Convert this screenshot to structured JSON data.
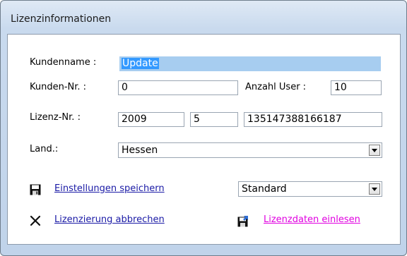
{
  "window": {
    "title": "Lizenzinformationen"
  },
  "form": {
    "kundenname_label": "Kundenname :",
    "kundenname_value": "Update",
    "kundennr_label": "Kunden-Nr. :",
    "kundennr_value": "0",
    "anzahl_user_label": "Anzahl User :",
    "anzahl_user_value": "10",
    "lizenznr_label": "Lizenz-Nr. :",
    "lizenznr_part1": "2009",
    "lizenznr_part2": "5",
    "lizenznr_part3": "135147388166187",
    "land_label": "Land.:",
    "land_value": "Hessen"
  },
  "actions": {
    "save_settings": "Einstellungen speichern",
    "profile_value": "Standard",
    "cancel_licensing": "Lizenzierung abbrechen",
    "read_license_data": "Lizenzdaten einlesen"
  },
  "colors": {
    "link": "#1a1aa6",
    "link_magenta": "#e000e0",
    "selection": "#3399ff"
  },
  "icons": {
    "save": "floppy-disk-icon",
    "cancel": "x-icon",
    "read": "floppy-arrow-icon"
  }
}
